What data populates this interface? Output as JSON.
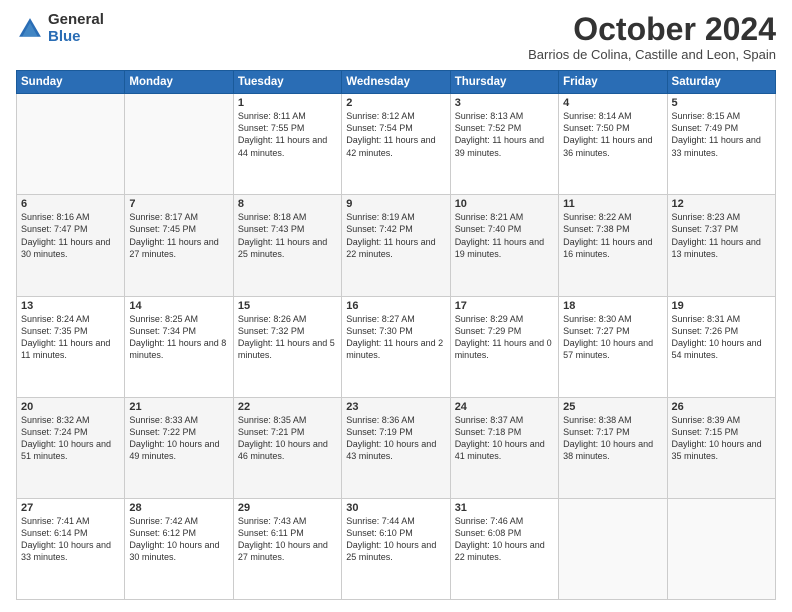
{
  "logo": {
    "general": "General",
    "blue": "Blue"
  },
  "title": "October 2024",
  "subtitle": "Barrios de Colina, Castille and Leon, Spain",
  "days_header": [
    "Sunday",
    "Monday",
    "Tuesday",
    "Wednesday",
    "Thursday",
    "Friday",
    "Saturday"
  ],
  "weeks": [
    [
      {
        "day": "",
        "info": ""
      },
      {
        "day": "",
        "info": ""
      },
      {
        "day": "1",
        "info": "Sunrise: 8:11 AM\nSunset: 7:55 PM\nDaylight: 11 hours and 44 minutes."
      },
      {
        "day": "2",
        "info": "Sunrise: 8:12 AM\nSunset: 7:54 PM\nDaylight: 11 hours and 42 minutes."
      },
      {
        "day": "3",
        "info": "Sunrise: 8:13 AM\nSunset: 7:52 PM\nDaylight: 11 hours and 39 minutes."
      },
      {
        "day": "4",
        "info": "Sunrise: 8:14 AM\nSunset: 7:50 PM\nDaylight: 11 hours and 36 minutes."
      },
      {
        "day": "5",
        "info": "Sunrise: 8:15 AM\nSunset: 7:49 PM\nDaylight: 11 hours and 33 minutes."
      }
    ],
    [
      {
        "day": "6",
        "info": "Sunrise: 8:16 AM\nSunset: 7:47 PM\nDaylight: 11 hours and 30 minutes."
      },
      {
        "day": "7",
        "info": "Sunrise: 8:17 AM\nSunset: 7:45 PM\nDaylight: 11 hours and 27 minutes."
      },
      {
        "day": "8",
        "info": "Sunrise: 8:18 AM\nSunset: 7:43 PM\nDaylight: 11 hours and 25 minutes."
      },
      {
        "day": "9",
        "info": "Sunrise: 8:19 AM\nSunset: 7:42 PM\nDaylight: 11 hours and 22 minutes."
      },
      {
        "day": "10",
        "info": "Sunrise: 8:21 AM\nSunset: 7:40 PM\nDaylight: 11 hours and 19 minutes."
      },
      {
        "day": "11",
        "info": "Sunrise: 8:22 AM\nSunset: 7:38 PM\nDaylight: 11 hours and 16 minutes."
      },
      {
        "day": "12",
        "info": "Sunrise: 8:23 AM\nSunset: 7:37 PM\nDaylight: 11 hours and 13 minutes."
      }
    ],
    [
      {
        "day": "13",
        "info": "Sunrise: 8:24 AM\nSunset: 7:35 PM\nDaylight: 11 hours and 11 minutes."
      },
      {
        "day": "14",
        "info": "Sunrise: 8:25 AM\nSunset: 7:34 PM\nDaylight: 11 hours and 8 minutes."
      },
      {
        "day": "15",
        "info": "Sunrise: 8:26 AM\nSunset: 7:32 PM\nDaylight: 11 hours and 5 minutes."
      },
      {
        "day": "16",
        "info": "Sunrise: 8:27 AM\nSunset: 7:30 PM\nDaylight: 11 hours and 2 minutes."
      },
      {
        "day": "17",
        "info": "Sunrise: 8:29 AM\nSunset: 7:29 PM\nDaylight: 11 hours and 0 minutes."
      },
      {
        "day": "18",
        "info": "Sunrise: 8:30 AM\nSunset: 7:27 PM\nDaylight: 10 hours and 57 minutes."
      },
      {
        "day": "19",
        "info": "Sunrise: 8:31 AM\nSunset: 7:26 PM\nDaylight: 10 hours and 54 minutes."
      }
    ],
    [
      {
        "day": "20",
        "info": "Sunrise: 8:32 AM\nSunset: 7:24 PM\nDaylight: 10 hours and 51 minutes."
      },
      {
        "day": "21",
        "info": "Sunrise: 8:33 AM\nSunset: 7:22 PM\nDaylight: 10 hours and 49 minutes."
      },
      {
        "day": "22",
        "info": "Sunrise: 8:35 AM\nSunset: 7:21 PM\nDaylight: 10 hours and 46 minutes."
      },
      {
        "day": "23",
        "info": "Sunrise: 8:36 AM\nSunset: 7:19 PM\nDaylight: 10 hours and 43 minutes."
      },
      {
        "day": "24",
        "info": "Sunrise: 8:37 AM\nSunset: 7:18 PM\nDaylight: 10 hours and 41 minutes."
      },
      {
        "day": "25",
        "info": "Sunrise: 8:38 AM\nSunset: 7:17 PM\nDaylight: 10 hours and 38 minutes."
      },
      {
        "day": "26",
        "info": "Sunrise: 8:39 AM\nSunset: 7:15 PM\nDaylight: 10 hours and 35 minutes."
      }
    ],
    [
      {
        "day": "27",
        "info": "Sunrise: 7:41 AM\nSunset: 6:14 PM\nDaylight: 10 hours and 33 minutes."
      },
      {
        "day": "28",
        "info": "Sunrise: 7:42 AM\nSunset: 6:12 PM\nDaylight: 10 hours and 30 minutes."
      },
      {
        "day": "29",
        "info": "Sunrise: 7:43 AM\nSunset: 6:11 PM\nDaylight: 10 hours and 27 minutes."
      },
      {
        "day": "30",
        "info": "Sunrise: 7:44 AM\nSunset: 6:10 PM\nDaylight: 10 hours and 25 minutes."
      },
      {
        "day": "31",
        "info": "Sunrise: 7:46 AM\nSunset: 6:08 PM\nDaylight: 10 hours and 22 minutes."
      },
      {
        "day": "",
        "info": ""
      },
      {
        "day": "",
        "info": ""
      }
    ]
  ]
}
